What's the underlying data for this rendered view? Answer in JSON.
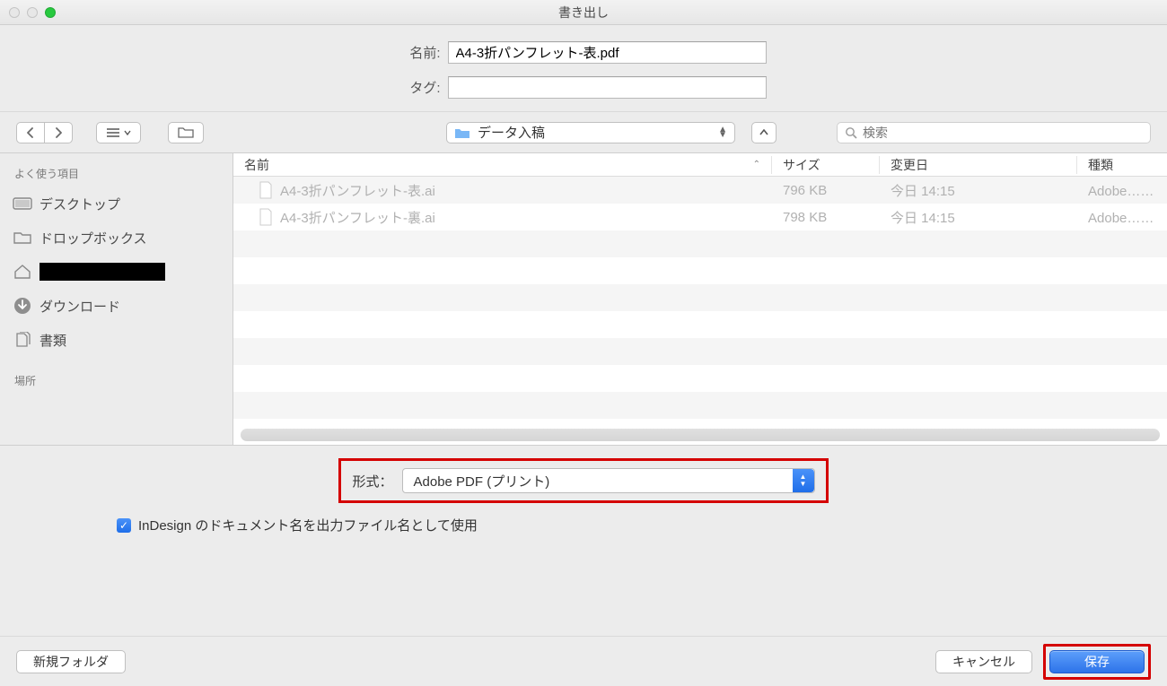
{
  "window": {
    "title": "書き出し"
  },
  "name_row": {
    "label": "名前:",
    "value": "A4-3折パンフレット-表.pdf"
  },
  "tag_row": {
    "label": "タグ:",
    "value": ""
  },
  "toolbar": {
    "folder": "データ入稿",
    "search_placeholder": "検索"
  },
  "sidebar": {
    "favorites_heading": "よく使う項目",
    "locations_heading": "場所",
    "items": [
      {
        "label": "デスクトップ"
      },
      {
        "label": "ドロップボックス"
      },
      {
        "label": ""
      },
      {
        "label": "ダウンロード"
      },
      {
        "label": "書類"
      }
    ]
  },
  "file_list": {
    "columns": {
      "name": "名前",
      "size": "サイズ",
      "modified": "変更日",
      "kind": "種類"
    },
    "rows": [
      {
        "name": "A4-3折パンフレット-表.ai",
        "size": "796 KB",
        "modified": "今日 14:15",
        "kind": "Adobe…ator書"
      },
      {
        "name": "A4-3折パンフレット-裏.ai",
        "size": "798 KB",
        "modified": "今日 14:15",
        "kind": "Adobe…ator書"
      }
    ]
  },
  "format": {
    "label": "形式：",
    "value": "Adobe PDF (プリント)"
  },
  "checkbox": {
    "label": "InDesign のドキュメント名を出力ファイル名として使用"
  },
  "footer": {
    "new_folder": "新規フォルダ",
    "cancel": "キャンセル",
    "save": "保存"
  }
}
